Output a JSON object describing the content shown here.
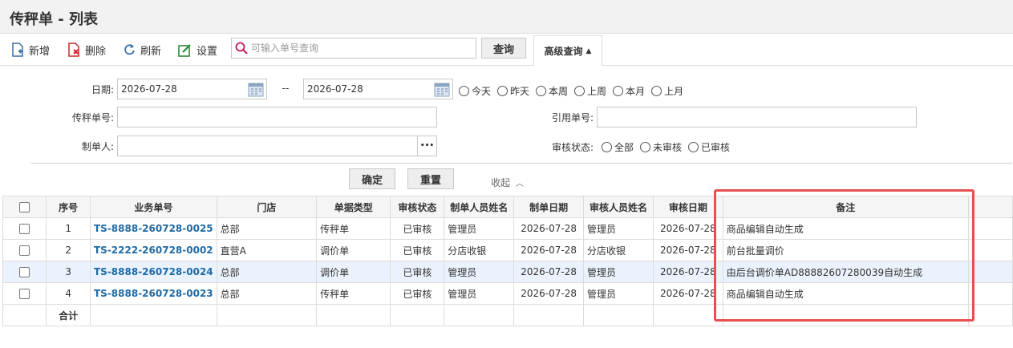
{
  "page": {
    "title": "传秤单 - 列表"
  },
  "toolbar": {
    "add_label": "新增",
    "delete_label": "删除",
    "refresh_label": "刷新",
    "settings_label": "设置",
    "search_placeholder": "可输入单号查询",
    "query_label": "查询",
    "advanced_label": "高级查询"
  },
  "filters": {
    "date_label": "日期:",
    "date_from": "2026-07-28",
    "date_sep": "--",
    "date_to": "2026-07-28",
    "quick_dates": [
      "今天",
      "昨天",
      "本周",
      "上周",
      "本月",
      "上月"
    ],
    "doc_no_label": "传秤单号:",
    "doc_no_value": "",
    "ref_no_label": "引用单号:",
    "ref_no_value": "",
    "maker_label": "制单人:",
    "maker_value": "",
    "maker_more": "•••",
    "audit_label": "审核状态:",
    "audit_options": [
      "全部",
      "未审核",
      "已审核"
    ],
    "confirm_label": "确定",
    "reset_label": "重置",
    "collapse_label": "收起"
  },
  "table": {
    "headers": [
      "序号",
      "业务单号",
      "门店",
      "单据类型",
      "审核状态",
      "制单人员姓名",
      "制单日期",
      "审核人员姓名",
      "审核日期",
      "备注"
    ],
    "rows": [
      {
        "idx": "1",
        "no": "TS-8888-260728-0025",
        "store": "总部",
        "type": "传秤单",
        "status": "已审核",
        "maker": "管理员",
        "make_date": "2026-07-28",
        "auditor": "管理员",
        "audit_date": "2026-07-28",
        "remark": "商品编辑自动生成"
      },
      {
        "idx": "2",
        "no": "TS-2222-260728-0002",
        "store": "直营A",
        "type": "调价单",
        "status": "已审核",
        "maker": "分店收银",
        "make_date": "2026-07-28",
        "auditor": "分店收银",
        "audit_date": "2026-07-28",
        "remark": "前台批量调价"
      },
      {
        "idx": "3",
        "no": "TS-8888-260728-0024",
        "store": "总部",
        "type": "调价单",
        "status": "已审核",
        "maker": "管理员",
        "make_date": "2026-07-28",
        "auditor": "管理员",
        "audit_date": "2026-07-28",
        "remark": "由后台调价单AD88882607280039自动生成"
      },
      {
        "idx": "4",
        "no": "TS-8888-260728-0023",
        "store": "总部",
        "type": "传秤单",
        "status": "已审核",
        "maker": "管理员",
        "make_date": "2026-07-28",
        "auditor": "管理员",
        "audit_date": "2026-07-28",
        "remark": "商品编辑自动生成"
      }
    ],
    "total_label": "合计"
  }
}
